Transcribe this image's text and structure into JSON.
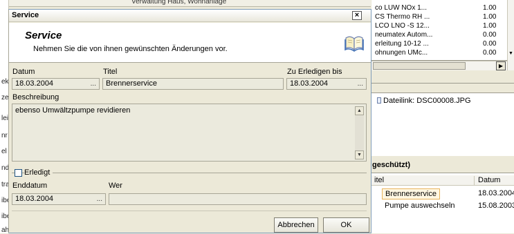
{
  "background": {
    "top_strip_text": "Verwaltung       Haus, Wohnanlage",
    "left_cut_labels": [
      "ek",
      "ze",
      "lei",
      "nr",
      "el",
      "nd",
      "tra",
      "ibe",
      "ibe",
      "ah"
    ],
    "list_rows": [
      {
        "name": "co LUW NOx 1...",
        "value": "1.00"
      },
      {
        "name": "CS Thermo RH ...",
        "value": "1.00"
      },
      {
        "name": "LCO LNO -S 12...",
        "value": "1.00"
      },
      {
        "name": "neumatex Autom...",
        "value": "0.00"
      },
      {
        "name": "erleitung 10-12 ...",
        "value": "0.00"
      },
      {
        "name": "ohnungen UMc...",
        "value": "0.00"
      }
    ],
    "file_link": "Dateilink: DSC00008.JPG",
    "section_title": "geschützt)",
    "table": {
      "headers": [
        "itel",
        "Datum"
      ],
      "rows": [
        {
          "title": "Brennerservice",
          "date": "18.03.2004"
        },
        {
          "title": "Pumpe auswechseln",
          "date": "15.08.2003"
        }
      ]
    }
  },
  "dialog": {
    "window_title": "Service",
    "close_glyph": "×",
    "header_title": "Service",
    "header_subtitle": "Nehmen Sie die von ihnen gewünschten Änderungen vor.",
    "labels": {
      "datum": "Datum",
      "titel": "Titel",
      "zu_erledigen": "Zu Erledigen bis",
      "beschreibung": "Beschreibung",
      "erledigt": "Erledigt",
      "enddatum": "Enddatum",
      "wer": "Wer"
    },
    "values": {
      "datum": "18.03.2004",
      "titel": "Brennerservice",
      "zu_erledigen": "18.03.2004",
      "beschreibung": "ebenso Umwältzpumpe revidieren",
      "enddatum": "18.03.2004",
      "wer": ""
    },
    "ellipsis": "...",
    "buttons": {
      "cancel": "Abbrechen",
      "ok": "OK"
    }
  }
}
